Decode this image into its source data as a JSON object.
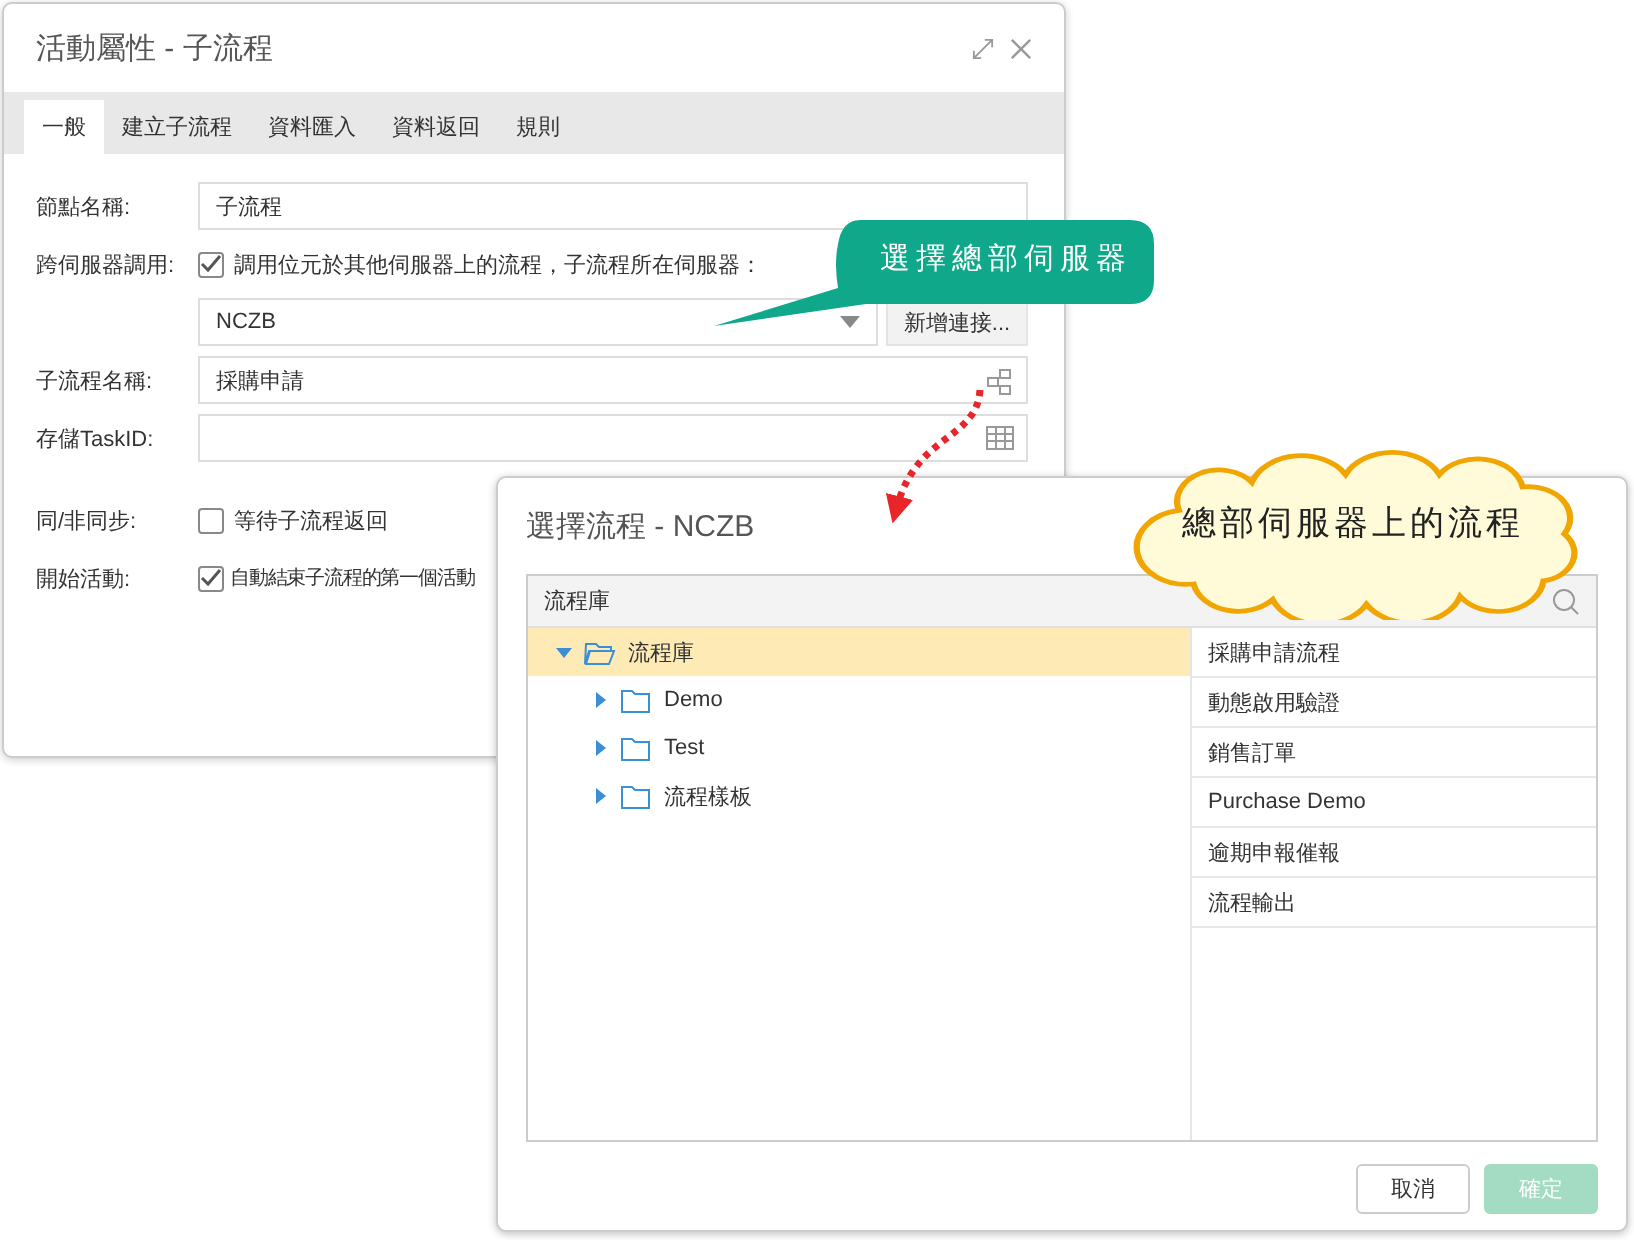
{
  "properties_dialog": {
    "title": "活動屬性 - 子流程",
    "tabs": [
      {
        "label": "一般",
        "selected": true
      },
      {
        "label": "建立子流程",
        "selected": false
      },
      {
        "label": "資料匯入",
        "selected": false
      },
      {
        "label": "資料返回",
        "selected": false
      },
      {
        "label": "規則",
        "selected": false
      }
    ],
    "fields": [
      {
        "kind": "text",
        "label": "節點名稱:",
        "value": "子流程"
      },
      {
        "kind": "checkbox",
        "label": "跨伺服器調用:",
        "text": "調用位元於其他伺服器上的流程，子流程所在伺服器：",
        "checked": true
      },
      {
        "kind": "select",
        "value": "NCZB",
        "button": "新增連接..."
      },
      {
        "kind": "flow_picker",
        "label": "子流程名稱:",
        "value": "採購申請"
      },
      {
        "kind": "table_picker",
        "label": "存儲TaskID:"
      },
      {
        "kind": "checkbox",
        "label": "同/非同步:",
        "text": "等待子流程返回",
        "checked": false
      },
      {
        "kind": "checkbox",
        "label": "開始活動:",
        "text": "自動結束子流程的第一個活動",
        "checked": true
      }
    ]
  },
  "select_dialog": {
    "title": "選擇流程 - NCZB",
    "panel_header": "流程庫",
    "tree": [
      {
        "label": "流程庫",
        "selected": true,
        "expanded": true,
        "children": [
          {
            "label": "Demo",
            "selected": false,
            "expanded": false
          },
          {
            "label": "Test",
            "selected": false,
            "expanded": false
          },
          {
            "label": "流程樣板",
            "selected": false,
            "expanded": false
          }
        ]
      }
    ],
    "processes": [
      "採購申請流程",
      "動態啟用驗證",
      "銷售訂單",
      "Purchase Demo",
      "逾期申報催報",
      "流程輸出"
    ],
    "buttons": [
      {
        "label": "取消",
        "disabled": false
      },
      {
        "label": "確定",
        "disabled": true
      }
    ]
  },
  "callouts": [
    {
      "kind": "speech",
      "text": "選擇總部伺服器"
    },
    {
      "kind": "cloud",
      "text": "總部伺服器上的流程"
    }
  ]
}
